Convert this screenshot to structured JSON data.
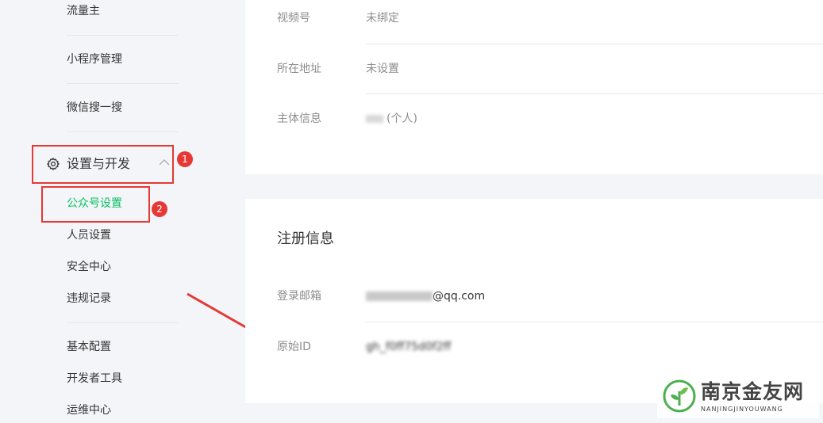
{
  "sidebar": {
    "items_top": [
      "流量主",
      "小程序管理",
      "微信搜一搜"
    ],
    "group": {
      "title": "设置与开发",
      "items": [
        "公众号设置",
        "人员设置",
        "安全中心",
        "违规记录"
      ]
    },
    "items_bottom": [
      "基本配置",
      "开发者工具",
      "运维中心"
    ]
  },
  "annotations": {
    "badge1": "1",
    "badge2": "2"
  },
  "account_card": {
    "rows": [
      {
        "label": "视频号",
        "value": "未绑定"
      },
      {
        "label": "所在地址",
        "value": "未设置"
      },
      {
        "label": "主体信息",
        "value": "(个人)"
      }
    ]
  },
  "register_card": {
    "title": "注册信息",
    "rows": [
      {
        "label": "登录邮箱",
        "value": "@qq.com"
      },
      {
        "label": "原始ID",
        "value": "gh_f0ff75d0f2ff"
      }
    ]
  },
  "watermark": {
    "name": "南京金友网",
    "sub": "NANJINGJINYOUWANG"
  },
  "colors": {
    "accent": "#07c160",
    "annotation": "#e53935"
  }
}
